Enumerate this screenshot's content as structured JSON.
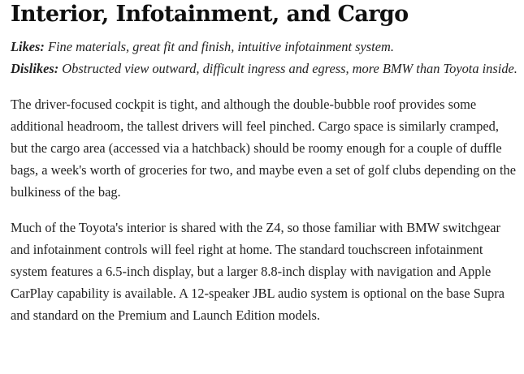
{
  "heading": "Interior, Infotainment, and Cargo",
  "verdict": {
    "likes_label": "Likes:",
    "likes_text": "Fine materials, great fit and finish, intuitive infotainment system.",
    "dislikes_label": "Dislikes:",
    "dislikes_text": "Obstructed view outward, difficult ingress and egress, more BMW than Toyota inside."
  },
  "paragraphs": [
    "The driver-focused cockpit is tight, and although the double-bubble roof provides some additional headroom, the tallest drivers will feel pinched. Cargo space is similarly cramped, but the cargo area (accessed via a hatchback) should be roomy enough for a couple of duffle bags, a week's worth of groceries for two, and maybe even a set of golf clubs depending on the bulkiness of the bag.",
    "Much of the Toyota's interior is shared with the Z4, so those familiar with BMW switchgear and infotainment controls will feel right at home. The standard touchscreen infotainment system features a 6.5-inch display, but a larger 8.8-inch display with navigation and Apple CarPlay capability is available. A 12-speaker JBL audio system is optional on the base Supra and standard on the Premium and Launch Edition models."
  ]
}
